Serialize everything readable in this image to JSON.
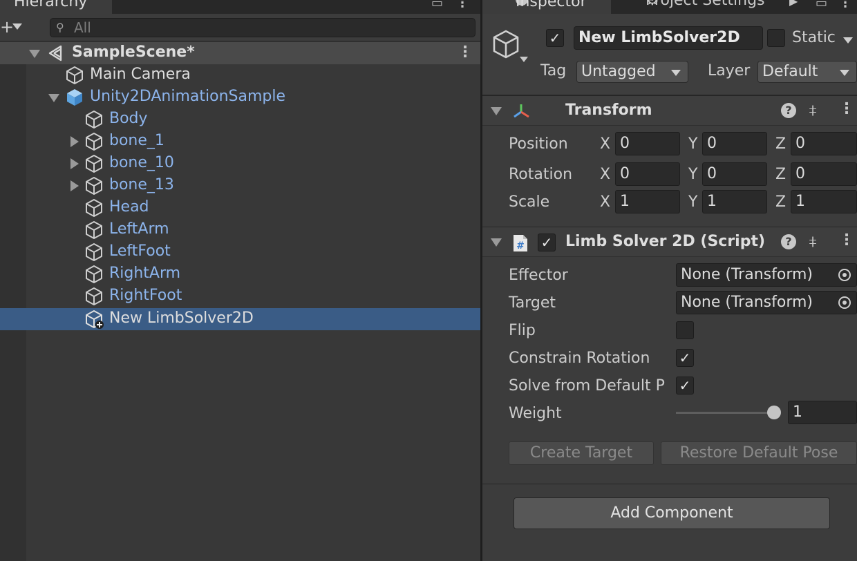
{
  "hierarchy": {
    "tab_label": "Hierarchy",
    "search_placeholder": "All",
    "add_glyph": "+",
    "scene_name": "SampleScene*",
    "items": [
      {
        "label": "Main Camera",
        "color": "white"
      },
      {
        "label": "Unity2DAnimationSample",
        "color": "blue"
      },
      {
        "label": "Body",
        "color": "blue"
      },
      {
        "label": "bone_1",
        "color": "blue"
      },
      {
        "label": "bone_10",
        "color": "blue"
      },
      {
        "label": "bone_13",
        "color": "blue"
      },
      {
        "label": "Head",
        "color": "blue"
      },
      {
        "label": "LeftArm",
        "color": "blue"
      },
      {
        "label": "LeftFoot",
        "color": "blue"
      },
      {
        "label": "RightArm",
        "color": "blue"
      },
      {
        "label": "RightFoot",
        "color": "blue"
      },
      {
        "label": "New LimbSolver2D",
        "color": "white",
        "selected": true
      }
    ]
  },
  "inspector": {
    "tab_label": "Inspector",
    "project_settings_label": "Project Settings",
    "object_name": "New LimbSolver2D",
    "active_check": "✓",
    "static_label": "Static",
    "tag_label": "Tag",
    "tag_value": "Untagged",
    "layer_label": "Layer",
    "layer_value": "Default",
    "transform": {
      "title": "Transform",
      "position_label": "Position",
      "rotation_label": "Rotation",
      "scale_label": "Scale",
      "axis_x": "X",
      "axis_y": "Y",
      "axis_z": "Z",
      "position": {
        "x": "0",
        "y": "0",
        "z": "0"
      },
      "rotation": {
        "x": "0",
        "y": "0",
        "z": "0"
      },
      "scale": {
        "x": "1",
        "y": "1",
        "z": "1"
      }
    },
    "limb_solver": {
      "title": "Limb Solver 2D (Script)",
      "enabled_check": "✓",
      "effector_label": "Effector",
      "effector_value": "None (Transform)",
      "target_label": "Target",
      "target_value": "None (Transform)",
      "flip_label": "Flip",
      "constrain_rotation_label": "Constrain Rotation",
      "constrain_rotation_check": "✓",
      "solve_default_label": "Solve from Default P",
      "solve_default_check": "✓",
      "weight_label": "Weight",
      "weight_value": "1",
      "create_target_label": "Create Target",
      "restore_pose_label": "Restore Default Pose"
    },
    "help_glyph": "?",
    "add_component_label": "Add Component"
  },
  "colors": {
    "selection": "#3a5c86",
    "prefab_text": "#8cb4ec",
    "accent": "#4f8fdb"
  }
}
